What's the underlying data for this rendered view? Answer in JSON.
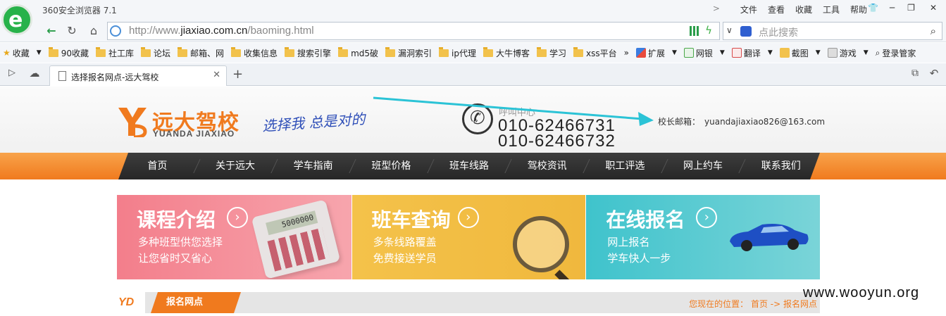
{
  "browser": {
    "title": "360安全浏览器 7.1",
    "menu": [
      "文件",
      "查看",
      "收藏",
      "工具",
      "帮助"
    ],
    "url_prefix": "http://www.",
    "url_domain": "jiaxiao.com.cn",
    "url_path": "/baoming.html",
    "search_placeholder": "点此搜索",
    "bookmarks": [
      "收藏",
      "90收藏",
      "社工库",
      "论坛",
      "邮箱、网",
      "收集信息",
      "搜索引擎",
      "md5破",
      "漏洞索引",
      "ip代理",
      "大牛博客",
      "学习",
      "xss平台"
    ],
    "bookmark_more": "»",
    "extensions": [
      "扩展",
      "网银",
      "翻译",
      "截图",
      "游戏",
      "登录管家"
    ],
    "tab_title": "选择报名网点-远大驾校"
  },
  "site": {
    "logo_cn": "远大驾校",
    "logo_en": "YUANDA JIAXIAO",
    "slogan": "选择我 总是对的",
    "hotline_label": "呼叫中心",
    "hotline1": "010-62466731",
    "hotline2": "010-62466732",
    "principal_label": "校长邮箱：",
    "principal_email": "yuandajiaxiao826@163.com",
    "nav": [
      "首页",
      "关于远大",
      "学车指南",
      "班型价格",
      "班车线路",
      "驾校资讯",
      "职工评选",
      "网上约车",
      "联系我们"
    ],
    "banners": [
      {
        "title": "课程介绍",
        "line1": "多种班型供您选择",
        "line2": "让您省时又省心"
      },
      {
        "title": "班车查询",
        "line1": "多条线路覆盖",
        "line2": "免费接送学员"
      },
      {
        "title": "在线报名",
        "line1": "网上报名",
        "line2": "学车快人一步"
      }
    ],
    "calc_display": "5000000",
    "crumb_logo": "YD",
    "crumb_title": "报名网点",
    "crumb_location": "您现在的位置： 首页 -> 报名网点"
  },
  "watermark": "www.wooyun.org",
  "colors": {
    "brand_orange": "#f07a1e",
    "browser_green": "#27b24a",
    "annotation_arrow": "#2bc3d6"
  }
}
